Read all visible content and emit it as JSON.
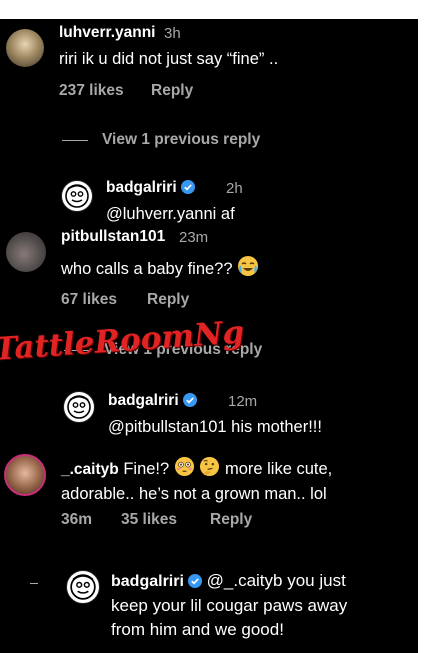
{
  "comments": [
    {
      "username": "luhverr.yanni",
      "time": "3h",
      "text": "riri ik u did not just say “fine” ..",
      "likes": "237 likes",
      "reply": "Reply",
      "view_replies": "View 1 previous reply"
    },
    {
      "username": "badgalriri",
      "verified": true,
      "time": "2h",
      "text": "@luhverr.yanni af"
    },
    {
      "username": "pitbullstan101",
      "time": "23m",
      "text": "who calls a baby fine??",
      "text_emoji": "face-with-tears",
      "likes": "67 likes",
      "reply": "Reply",
      "view_replies": "View 1 previous reply"
    },
    {
      "username": "badgalriri",
      "verified": true,
      "time": "12m",
      "text": "@pitbullstan101 his mother!!!"
    },
    {
      "username": "_.caityb",
      "text_line1_after_emoji": "more like cute,",
      "text_line1_prefix": "Fine!?",
      "text_line2": "adorable.. he’s not a grown man.. lol",
      "emojis": [
        "flushed-face",
        "thinking-face"
      ],
      "time": "36m",
      "likes": "35 likes",
      "reply": "Reply"
    },
    {
      "username": "badgalriri",
      "verified": true,
      "text_line1": "@_.caityb you just",
      "text_line2": "keep your lil cougar paws away",
      "text_line3": "from him and we good!"
    }
  ],
  "watermark": "TattleRoomNg",
  "colors": {
    "background": "#000000",
    "text": "#ffffff",
    "secondary": "#a8a8a8",
    "verified": "#3897f0",
    "watermark": "#e02424"
  }
}
